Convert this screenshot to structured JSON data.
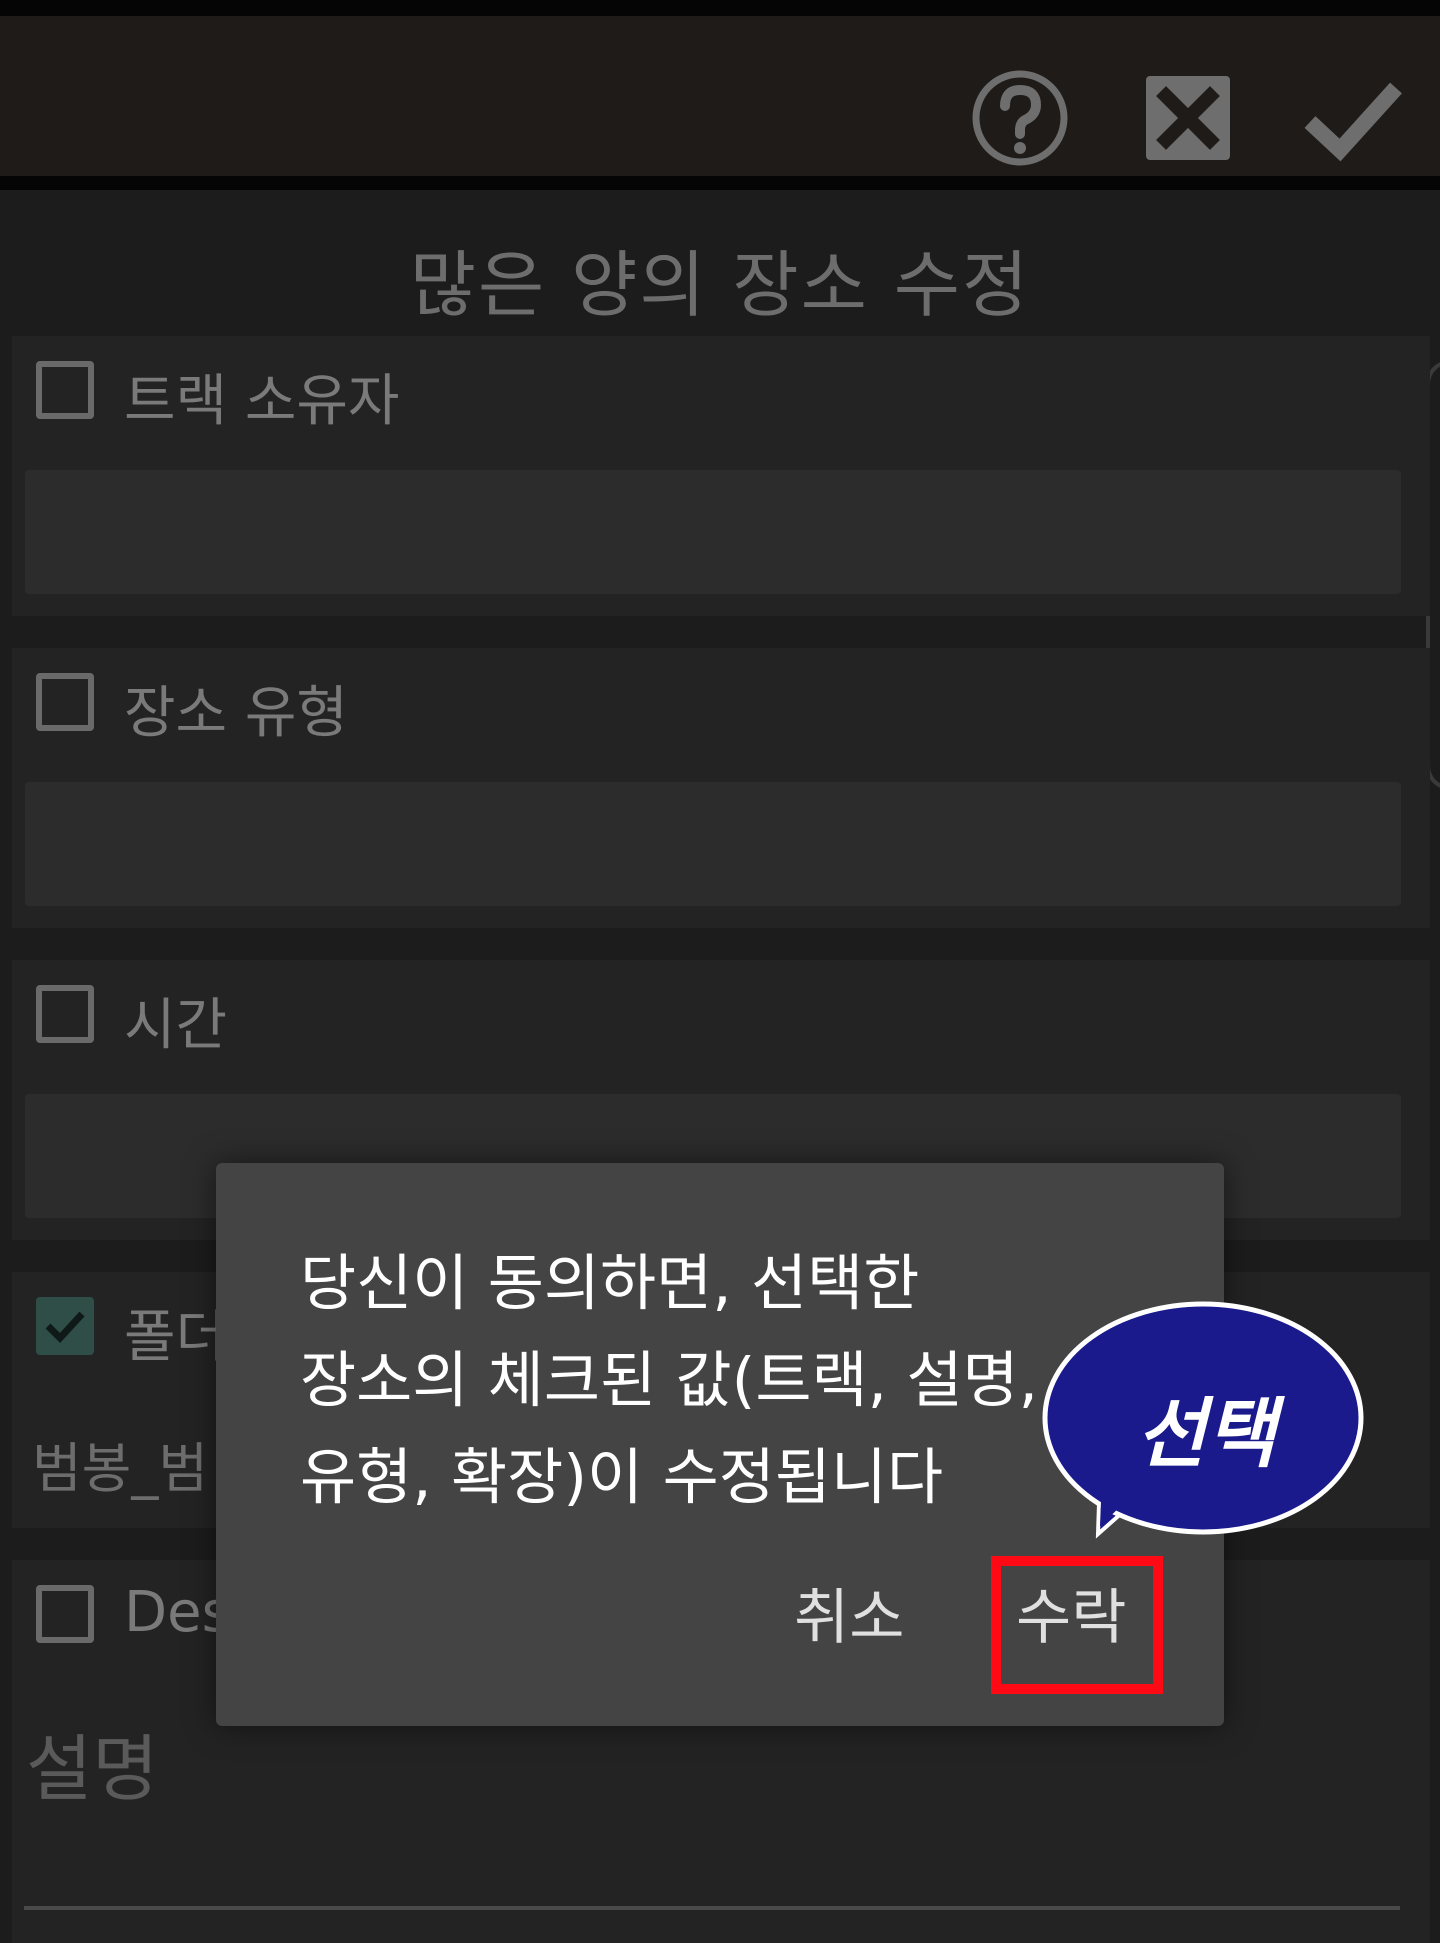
{
  "toolbar": {
    "help_icon": "help-circle-icon",
    "close_icon": "close-box-icon",
    "confirm_icon": "check-icon"
  },
  "page_title": "많은 양의 장소 수정",
  "sections": [
    {
      "label": "트랙 소유자",
      "checked": false
    },
    {
      "label": "장소 유형",
      "checked": false
    },
    {
      "label": "시간",
      "checked": false
    },
    {
      "label": "폴더",
      "checked": true,
      "value": "범봉_범"
    },
    {
      "label": "Des",
      "checked": false
    }
  ],
  "description_placeholder": "설명",
  "dialog": {
    "message_lines": [
      "당신이 동의하면, 선택한",
      "장소의 체크된 값(트랙, 설명,",
      "유형, 확장)이 수정됩니다"
    ],
    "cancel_label": "취소",
    "accept_label": "수락"
  },
  "annotation": {
    "bubble_text": "선택",
    "highlight_color": "#ff0a14",
    "bubble_color": "#1a1a8c"
  }
}
